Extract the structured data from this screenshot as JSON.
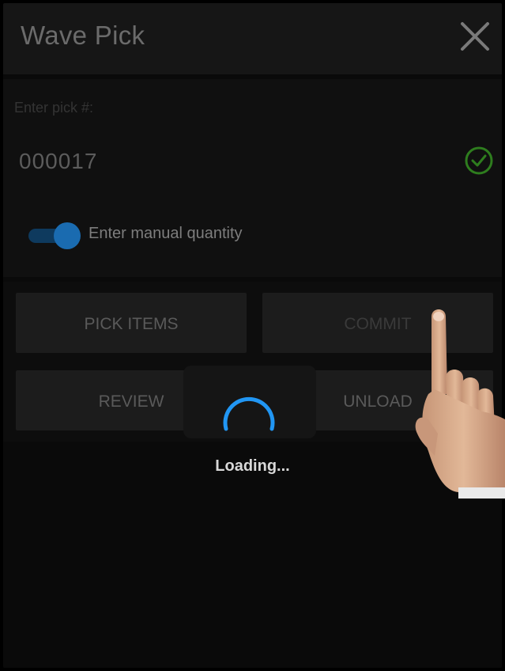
{
  "header": {
    "title": "Wave Pick",
    "close_icon": "close-icon"
  },
  "form": {
    "pick_label": "Enter pick #:",
    "pick_value": "000017",
    "valid_icon": "check-circle-icon",
    "manual_quantity_label": "Enter manual quantity",
    "manual_quantity_enabled": true
  },
  "actions": {
    "pick_items": "PICK ITEMS",
    "commit": "COMMIT",
    "review": "REVIEW",
    "unload": "UNLOAD"
  },
  "overlay": {
    "loading_text": "Loading..."
  },
  "colors": {
    "accent_blue": "#1a6bb0",
    "valid_green": "#2e7d1e",
    "spinner_blue": "#2196f3"
  }
}
